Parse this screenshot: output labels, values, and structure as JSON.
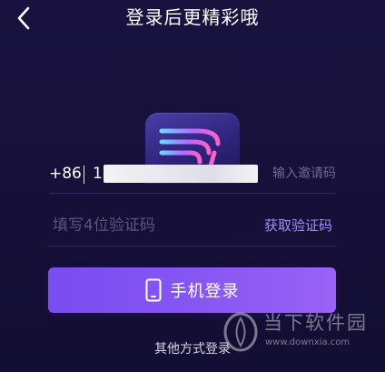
{
  "header": {
    "title": "登录后更精彩哦",
    "back_icon": "chevron-left-icon"
  },
  "logo": {
    "icon": "app-logo-icon",
    "colors": [
      "#6fd6ff",
      "#b46bff",
      "#ff5fc8"
    ]
  },
  "phone_row": {
    "country_code": "+86",
    "phone_value": "1",
    "invite_placeholder": "输入邀请码"
  },
  "code_row": {
    "placeholder": "填写4位验证码",
    "get_code_label": "获取验证码"
  },
  "login_button": {
    "label": "手机登录",
    "icon": "smartphone-icon"
  },
  "other_login": {
    "label": "其他方式登录"
  },
  "watermark": {
    "name": "当下软件园",
    "url": "www.downxia.com"
  },
  "colors": {
    "background": "#161039",
    "accent": "#a58cff",
    "button": "#8656f2"
  }
}
